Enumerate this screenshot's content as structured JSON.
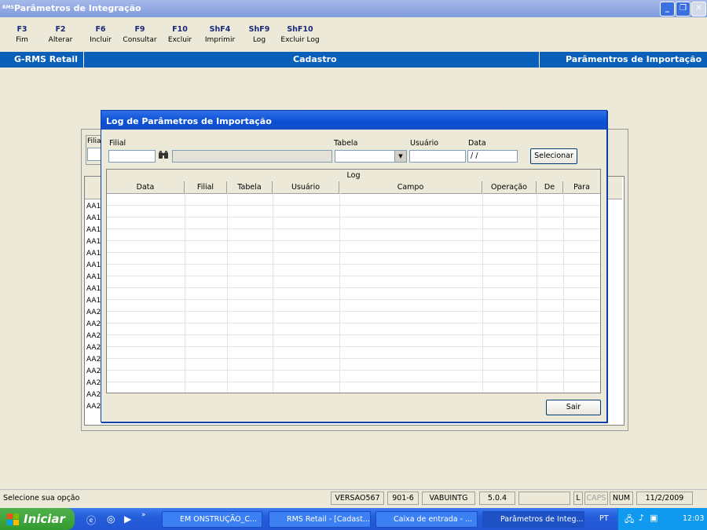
{
  "window": {
    "title": "Parâmetros de Integração",
    "app_icon_text": "RMS"
  },
  "fkeys": [
    {
      "key": "F3",
      "label": "Fim"
    },
    {
      "key": "F2",
      "label": "Alterar"
    },
    {
      "key": "F6",
      "label": "Incluir"
    },
    {
      "key": "F9",
      "label": "Consultar"
    },
    {
      "key": "F10",
      "label": "Excluir"
    },
    {
      "key": "ShF4",
      "label": "Imprimir"
    },
    {
      "key": "ShF9",
      "label": "Log"
    },
    {
      "key": "ShF10",
      "label": "Excluir Log"
    }
  ],
  "header": {
    "left": "G-RMS Retail",
    "center": "Cadastro",
    "right": "Parâmentros de Importação"
  },
  "background": {
    "filial_label": "Filial",
    "rows": [
      "AA1",
      "AA1",
      "AA1",
      "AA1",
      "AA1",
      "AA1",
      "AA1",
      "AA1",
      "AA1",
      "AA2",
      "AA2",
      "AA2",
      "AA2",
      "AA2",
      "AA2",
      "AA2",
      "AA2",
      "AA2"
    ]
  },
  "dialog": {
    "title": "Log de Parâmetros de Importação",
    "filial_label": "Filial",
    "tabela_label": "Tabela",
    "usuario_label": "Usuário",
    "data_label": "Data",
    "data_value": " / /",
    "select_button": "Selecionar",
    "grid_caption": "Log",
    "columns": [
      "Data",
      "Filial",
      "Tabela",
      "Usuário",
      "Campo",
      "Operação",
      "De",
      "Para"
    ],
    "exit_button": "Sair"
  },
  "status": {
    "message": "Selecione sua opção",
    "version": "VERSAO567",
    "code": "901-6",
    "module": "VABUINTG",
    "release": "5.0.4",
    "l": "L",
    "caps": "CAPS",
    "num": "NUM",
    "date": "11/2/2009"
  },
  "taskbar": {
    "start": "Iniciar",
    "buttons": [
      "EM ONSTRUÇÃO_C...",
      "RMS Retail - [Cadast...",
      "Caixa de entrada - ...",
      "Parâmetros de Integ..."
    ],
    "lang": "PT",
    "clock": "12:03"
  }
}
